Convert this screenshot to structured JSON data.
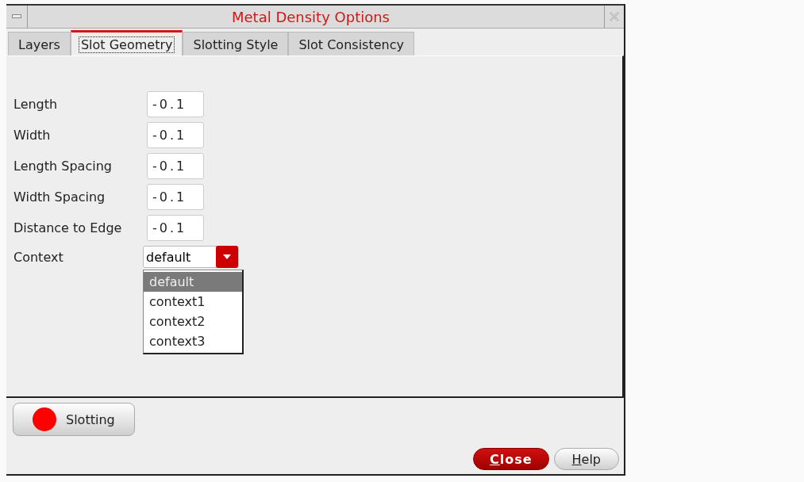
{
  "window": {
    "title": "Metal Density Options"
  },
  "tabs": [
    {
      "label": "Layers",
      "selected": false
    },
    {
      "label": "Slot Geometry",
      "selected": true
    },
    {
      "label": "Slotting Style",
      "selected": false
    },
    {
      "label": "Slot Consistency",
      "selected": false
    }
  ],
  "fields": [
    {
      "label": "Length",
      "value": "-0.1"
    },
    {
      "label": "Width",
      "value": "-0.1"
    },
    {
      "label": "Length Spacing",
      "value": "-0.1"
    },
    {
      "label": "Width Spacing",
      "value": "-0.1"
    },
    {
      "label": "Distance to Edge",
      "value": "-0.1"
    }
  ],
  "context": {
    "label": "Context",
    "value": "default",
    "expanded": true,
    "options": [
      {
        "label": "default",
        "selected": true
      },
      {
        "label": "context1",
        "selected": false
      },
      {
        "label": "context2",
        "selected": false
      },
      {
        "label": "context3",
        "selected": false
      }
    ]
  },
  "slotting": {
    "label": "Slotting",
    "on": true
  },
  "buttons": [
    {
      "label": "Close",
      "kind": "primary"
    },
    {
      "label": "Help",
      "kind": "normal"
    }
  ]
}
